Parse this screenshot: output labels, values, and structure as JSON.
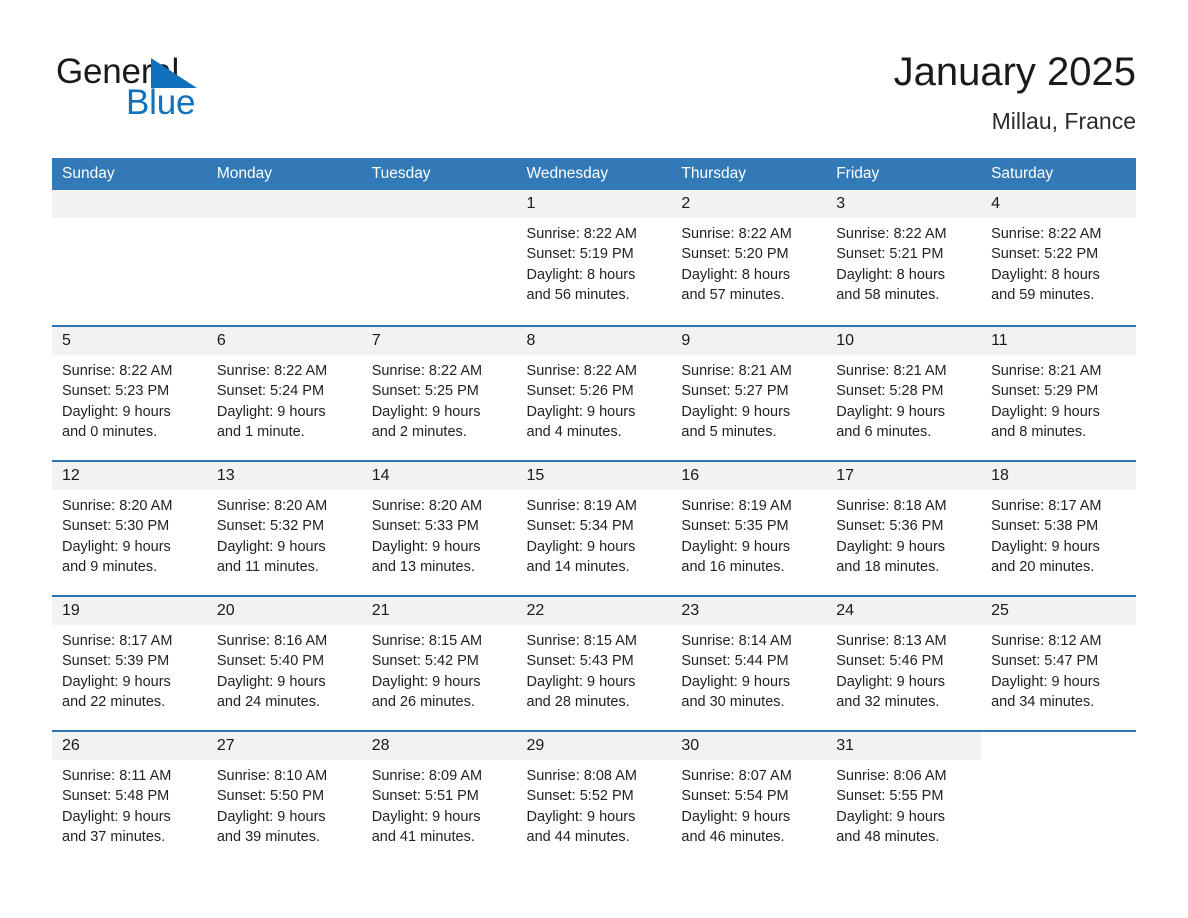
{
  "brand": {
    "line1": "General",
    "line2": "Blue",
    "mark": "triangle-logo-mark",
    "accent_color": "#1271bd"
  },
  "header": {
    "title": "January 2025",
    "location": "Millau, France"
  },
  "theme": {
    "header_blue": "#3279b7",
    "row_rule_blue": "#2e74b5",
    "daynum_band": "#f2f2f2",
    "text": "#222222"
  },
  "calendar": {
    "weekday_headers": [
      "Sunday",
      "Monday",
      "Tuesday",
      "Wednesday",
      "Thursday",
      "Friday",
      "Saturday"
    ],
    "weeks": [
      [
        {
          "day": "",
          "lines": []
        },
        {
          "day": "",
          "lines": []
        },
        {
          "day": "",
          "lines": []
        },
        {
          "day": "1",
          "lines": [
            "Sunrise: 8:22 AM",
            "Sunset: 5:19 PM",
            "Daylight: 8 hours",
            "and 56 minutes."
          ]
        },
        {
          "day": "2",
          "lines": [
            "Sunrise: 8:22 AM",
            "Sunset: 5:20 PM",
            "Daylight: 8 hours",
            "and 57 minutes."
          ]
        },
        {
          "day": "3",
          "lines": [
            "Sunrise: 8:22 AM",
            "Sunset: 5:21 PM",
            "Daylight: 8 hours",
            "and 58 minutes."
          ]
        },
        {
          "day": "4",
          "lines": [
            "Sunrise: 8:22 AM",
            "Sunset: 5:22 PM",
            "Daylight: 8 hours",
            "and 59 minutes."
          ]
        }
      ],
      [
        {
          "day": "5",
          "lines": [
            "Sunrise: 8:22 AM",
            "Sunset: 5:23 PM",
            "Daylight: 9 hours",
            "and 0 minutes."
          ]
        },
        {
          "day": "6",
          "lines": [
            "Sunrise: 8:22 AM",
            "Sunset: 5:24 PM",
            "Daylight: 9 hours",
            "and 1 minute."
          ]
        },
        {
          "day": "7",
          "lines": [
            "Sunrise: 8:22 AM",
            "Sunset: 5:25 PM",
            "Daylight: 9 hours",
            "and 2 minutes."
          ]
        },
        {
          "day": "8",
          "lines": [
            "Sunrise: 8:22 AM",
            "Sunset: 5:26 PM",
            "Daylight: 9 hours",
            "and 4 minutes."
          ]
        },
        {
          "day": "9",
          "lines": [
            "Sunrise: 8:21 AM",
            "Sunset: 5:27 PM",
            "Daylight: 9 hours",
            "and 5 minutes."
          ]
        },
        {
          "day": "10",
          "lines": [
            "Sunrise: 8:21 AM",
            "Sunset: 5:28 PM",
            "Daylight: 9 hours",
            "and 6 minutes."
          ]
        },
        {
          "day": "11",
          "lines": [
            "Sunrise: 8:21 AM",
            "Sunset: 5:29 PM",
            "Daylight: 9 hours",
            "and 8 minutes."
          ]
        }
      ],
      [
        {
          "day": "12",
          "lines": [
            "Sunrise: 8:20 AM",
            "Sunset: 5:30 PM",
            "Daylight: 9 hours",
            "and 9 minutes."
          ]
        },
        {
          "day": "13",
          "lines": [
            "Sunrise: 8:20 AM",
            "Sunset: 5:32 PM",
            "Daylight: 9 hours",
            "and 11 minutes."
          ]
        },
        {
          "day": "14",
          "lines": [
            "Sunrise: 8:20 AM",
            "Sunset: 5:33 PM",
            "Daylight: 9 hours",
            "and 13 minutes."
          ]
        },
        {
          "day": "15",
          "lines": [
            "Sunrise: 8:19 AM",
            "Sunset: 5:34 PM",
            "Daylight: 9 hours",
            "and 14 minutes."
          ]
        },
        {
          "day": "16",
          "lines": [
            "Sunrise: 8:19 AM",
            "Sunset: 5:35 PM",
            "Daylight: 9 hours",
            "and 16 minutes."
          ]
        },
        {
          "day": "17",
          "lines": [
            "Sunrise: 8:18 AM",
            "Sunset: 5:36 PM",
            "Daylight: 9 hours",
            "and 18 minutes."
          ]
        },
        {
          "day": "18",
          "lines": [
            "Sunrise: 8:17 AM",
            "Sunset: 5:38 PM",
            "Daylight: 9 hours",
            "and 20 minutes."
          ]
        }
      ],
      [
        {
          "day": "19",
          "lines": [
            "Sunrise: 8:17 AM",
            "Sunset: 5:39 PM",
            "Daylight: 9 hours",
            "and 22 minutes."
          ]
        },
        {
          "day": "20",
          "lines": [
            "Sunrise: 8:16 AM",
            "Sunset: 5:40 PM",
            "Daylight: 9 hours",
            "and 24 minutes."
          ]
        },
        {
          "day": "21",
          "lines": [
            "Sunrise: 8:15 AM",
            "Sunset: 5:42 PM",
            "Daylight: 9 hours",
            "and 26 minutes."
          ]
        },
        {
          "day": "22",
          "lines": [
            "Sunrise: 8:15 AM",
            "Sunset: 5:43 PM",
            "Daylight: 9 hours",
            "and 28 minutes."
          ]
        },
        {
          "day": "23",
          "lines": [
            "Sunrise: 8:14 AM",
            "Sunset: 5:44 PM",
            "Daylight: 9 hours",
            "and 30 minutes."
          ]
        },
        {
          "day": "24",
          "lines": [
            "Sunrise: 8:13 AM",
            "Sunset: 5:46 PM",
            "Daylight: 9 hours",
            "and 32 minutes."
          ]
        },
        {
          "day": "25",
          "lines": [
            "Sunrise: 8:12 AM",
            "Sunset: 5:47 PM",
            "Daylight: 9 hours",
            "and 34 minutes."
          ]
        }
      ],
      [
        {
          "day": "26",
          "lines": [
            "Sunrise: 8:11 AM",
            "Sunset: 5:48 PM",
            "Daylight: 9 hours",
            "and 37 minutes."
          ]
        },
        {
          "day": "27",
          "lines": [
            "Sunrise: 8:10 AM",
            "Sunset: 5:50 PM",
            "Daylight: 9 hours",
            "and 39 minutes."
          ]
        },
        {
          "day": "28",
          "lines": [
            "Sunrise: 8:09 AM",
            "Sunset: 5:51 PM",
            "Daylight: 9 hours",
            "and 41 minutes."
          ]
        },
        {
          "day": "29",
          "lines": [
            "Sunrise: 8:08 AM",
            "Sunset: 5:52 PM",
            "Daylight: 9 hours",
            "and 44 minutes."
          ]
        },
        {
          "day": "30",
          "lines": [
            "Sunrise: 8:07 AM",
            "Sunset: 5:54 PM",
            "Daylight: 9 hours",
            "and 46 minutes."
          ]
        },
        {
          "day": "31",
          "lines": [
            "Sunrise: 8:06 AM",
            "Sunset: 5:55 PM",
            "Daylight: 9 hours",
            "and 48 minutes."
          ]
        },
        {
          "day": "",
          "lines": []
        }
      ]
    ]
  }
}
